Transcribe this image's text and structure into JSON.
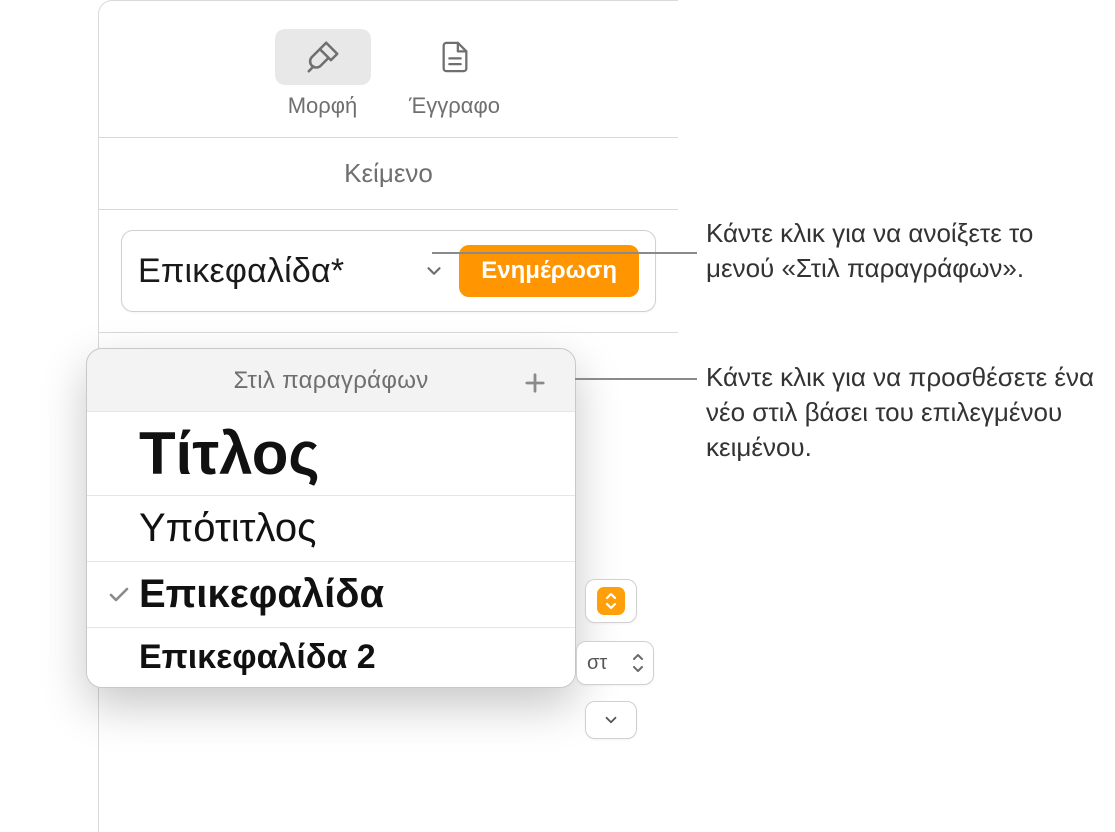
{
  "toolbar": {
    "format_label": "Μορφή",
    "document_label": "Έγγραφο"
  },
  "section_tab": "Κείμενο",
  "style_field": {
    "name": "Επικεφαλίδα*",
    "update_label": "Ενημέρωση"
  },
  "popover": {
    "title": "Στιλ παραγράφων",
    "items": [
      {
        "label": "Τίτλος",
        "kind": "title",
        "checked": false
      },
      {
        "label": "Υπότιτλος",
        "kind": "subtitle",
        "checked": false
      },
      {
        "label": "Επικεφαλίδα",
        "kind": "heading",
        "checked": true
      },
      {
        "label": "Επικεφαλίδα 2",
        "kind": "heading2",
        "checked": false
      }
    ]
  },
  "stepper": {
    "value_suffix": "στ"
  },
  "callouts": {
    "open_menu": "Κάντε κλικ για να ανοίξετε το μενού «Στιλ παραγράφων».",
    "add_style": "Κάντε κλικ για να προσθέσετε ένα νέο στιλ βάσει του επιλεγμένου κειμένου."
  }
}
